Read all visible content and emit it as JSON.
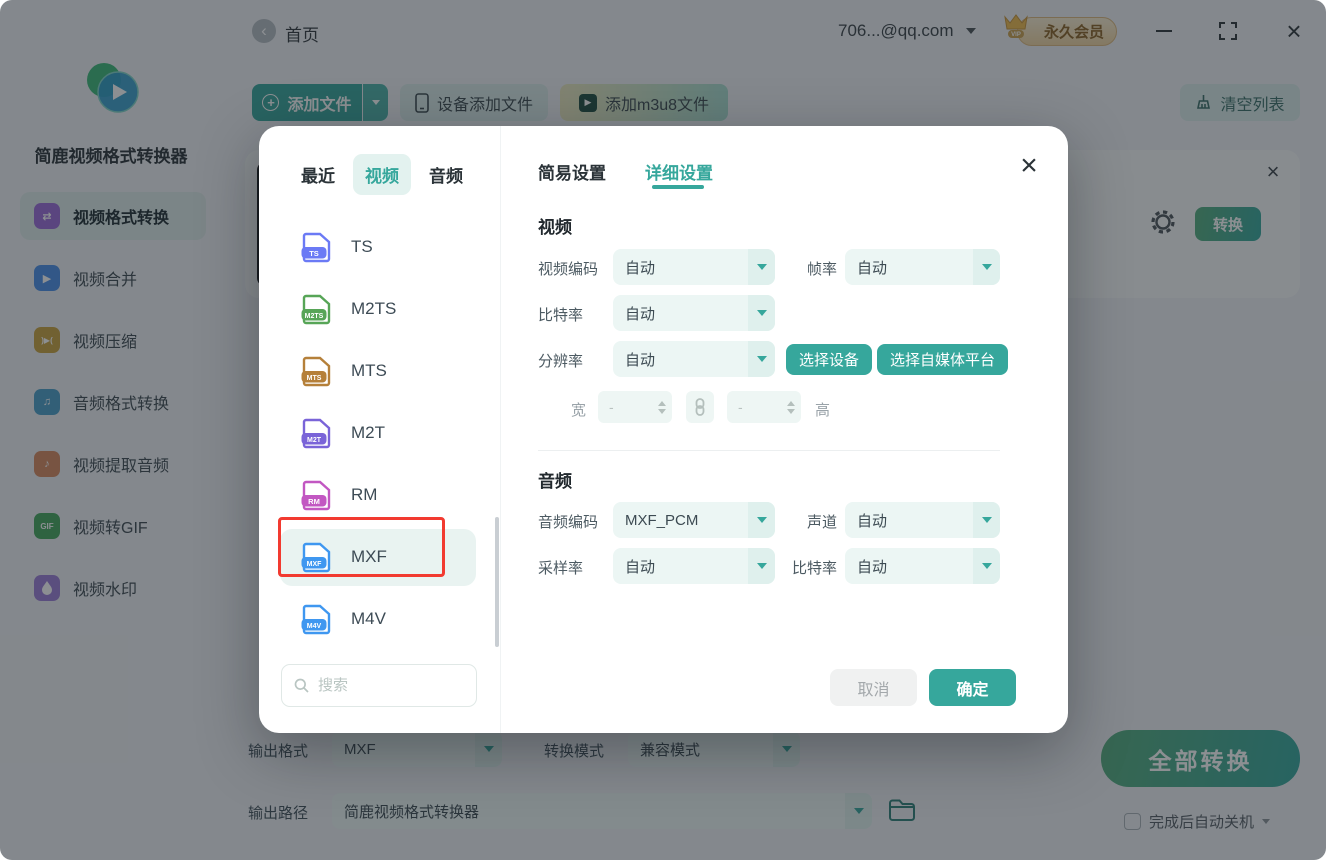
{
  "titlebar": {
    "home": "首页",
    "account": "706...@qq.com",
    "vip_label": "永久会员"
  },
  "app": {
    "name": "简鹿视频格式转换器"
  },
  "sidebar": {
    "items": [
      {
        "label": "视频格式转换",
        "color": "#9a6bd8",
        "active": true
      },
      {
        "label": "视频合并",
        "color": "#4a8fe8",
        "active": false
      },
      {
        "label": "视频压缩",
        "color": "#c9a23f",
        "active": false
      },
      {
        "label": "音频格式转换",
        "color": "#4a9ec9",
        "active": false
      },
      {
        "label": "视频提取音频",
        "color": "#d6895f",
        "active": false
      },
      {
        "label": "视频转GIF",
        "color": "#44a75c",
        "active": false
      },
      {
        "label": "视频水印",
        "color": "#9a7dd6",
        "active": false
      }
    ]
  },
  "toolbar": {
    "add_file": "添加文件",
    "device_add": "设备添加文件",
    "add_m3u8": "添加m3u8文件",
    "clear_list": "清空列表"
  },
  "file_row": {
    "convert_label": "转换"
  },
  "footer": {
    "output_format_label": "输出格式",
    "output_format_value": "MXF",
    "convert_mode_label": "转换模式",
    "convert_mode_value": "兼容模式",
    "output_path_label": "输出路径",
    "output_path_value": "简鹿视频格式转换器",
    "convert_all_label": "全部转换",
    "shutdown_label": "完成后自动关机"
  },
  "modal": {
    "format_tabs": {
      "recent": "最近",
      "video": "视频",
      "audio": "音频"
    },
    "formats": [
      {
        "name": "TS",
        "color": "#6b7af5"
      },
      {
        "name": "M2TS",
        "color": "#57a557"
      },
      {
        "name": "MTS",
        "color": "#b5803a"
      },
      {
        "name": "M2T",
        "color": "#7a64d8"
      },
      {
        "name": "RM",
        "color": "#c257c2"
      },
      {
        "name": "MXF",
        "color": "#3f97f0",
        "selected": true
      },
      {
        "name": "M4V",
        "color": "#3f97f0"
      }
    ],
    "search_placeholder": "搜索",
    "settings_tabs": {
      "simple": "简易设置",
      "detail": "详细设置"
    },
    "video": {
      "section": "视频",
      "codec_label": "视频编码",
      "codec_value": "自动",
      "fps_label": "帧率",
      "fps_value": "自动",
      "bitrate_label": "比特率",
      "bitrate_value": "自动",
      "resolution_label": "分辨率",
      "resolution_value": "自动",
      "select_device": "选择设备",
      "select_platform": "选择自媒体平台",
      "width_label": "宽",
      "height_label": "高",
      "dim_placeholder": "-"
    },
    "audio": {
      "section": "音频",
      "codec_label": "音频编码",
      "codec_value": "MXF_PCM",
      "channel_label": "声道",
      "channel_value": "自动",
      "sample_label": "采样率",
      "sample_value": "自动",
      "bitrate_label": "比特率",
      "bitrate_value": "自动"
    },
    "cancel_label": "取消",
    "ok_label": "确定"
  },
  "colors": {
    "accent": "#36a79c",
    "highlight_red": "#f23a30",
    "gradient_start": "#55ad7d",
    "gradient_end": "#35a79d"
  }
}
